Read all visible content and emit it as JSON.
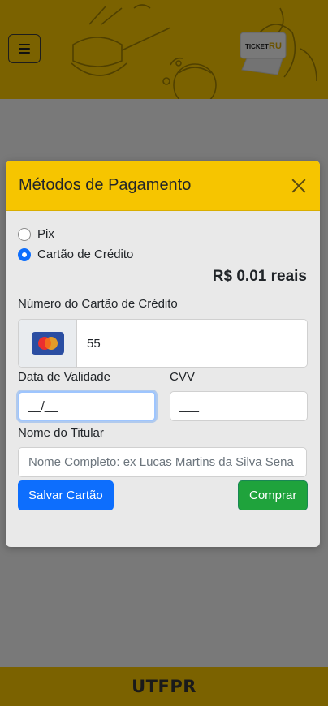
{
  "header": {
    "menu_icon": "hamburger-icon",
    "logo_text_ticket": "TICKET",
    "logo_text_ru": "RU"
  },
  "footer": {
    "text": "UTFPR"
  },
  "modal": {
    "title": "Métodos de Pagamento",
    "close_icon": "close-icon",
    "payment_options": [
      {
        "label": "Pix",
        "selected": false
      },
      {
        "label": "Cartão de Crédito",
        "selected": true
      }
    ],
    "price": "R$ 0.01 reais",
    "card_number_label": "Número do Cartão de Crédito",
    "card_number_value": "55",
    "card_brand_icon": "mastercard-icon",
    "expiry_label": "Data de Validade",
    "expiry_value": "__/__",
    "cvv_label": "CVV",
    "cvv_value": "___",
    "holder_label": "Nome do Titular",
    "holder_placeholder": "Nome Completo: ex Lucas Martins da Silva Sena",
    "save_button": "Salvar Cartão",
    "buy_button": "Comprar"
  },
  "colors": {
    "brand_yellow": "#f6c500",
    "primary_blue": "#0d6efd",
    "success_green": "#1fa33c"
  }
}
